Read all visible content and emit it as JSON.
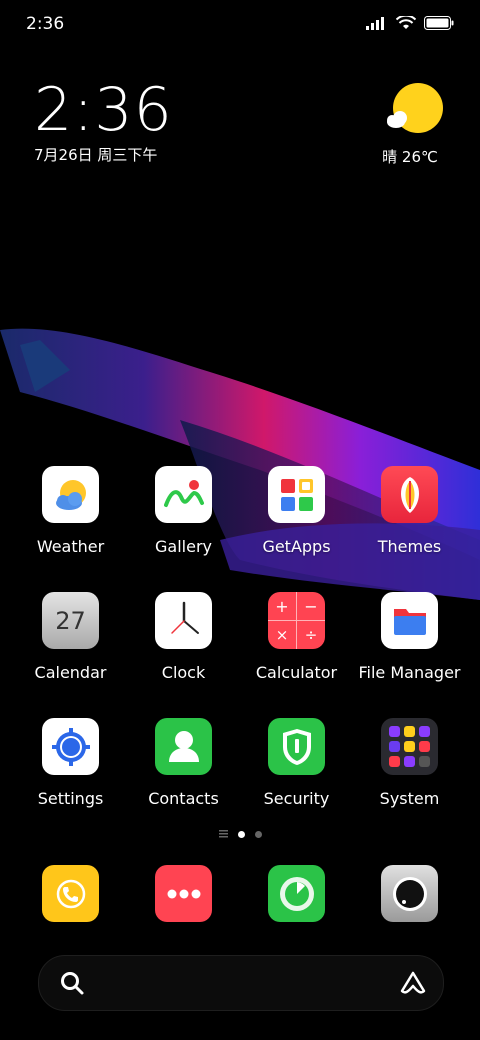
{
  "status_bar": {
    "time": "2:36"
  },
  "clock_widget": {
    "time": "2:36",
    "date": "7月26日 周三下午"
  },
  "weather_widget": {
    "condition": "晴",
    "temperature": "26℃",
    "text": "晴 26℃"
  },
  "apps": [
    {
      "label": "Weather"
    },
    {
      "label": "Gallery"
    },
    {
      "label": "GetApps"
    },
    {
      "label": "Themes"
    },
    {
      "label": "Calendar",
      "icon_text": "27"
    },
    {
      "label": "Clock"
    },
    {
      "label": "Calculator"
    },
    {
      "label": "File Manager"
    },
    {
      "label": "Settings"
    },
    {
      "label": "Contacts"
    },
    {
      "label": "Security"
    },
    {
      "label": "System"
    }
  ],
  "page_indicator": {
    "pages": 2,
    "active": 0
  },
  "dock": [
    {
      "name": "phone",
      "icon": "phone-icon"
    },
    {
      "name": "messages",
      "icon": "messages-icon"
    },
    {
      "name": "browser",
      "icon": "compass-icon"
    },
    {
      "name": "camera",
      "icon": "camera-icon"
    }
  ],
  "colors": {
    "background": "#000000",
    "text": "#ffffff"
  }
}
